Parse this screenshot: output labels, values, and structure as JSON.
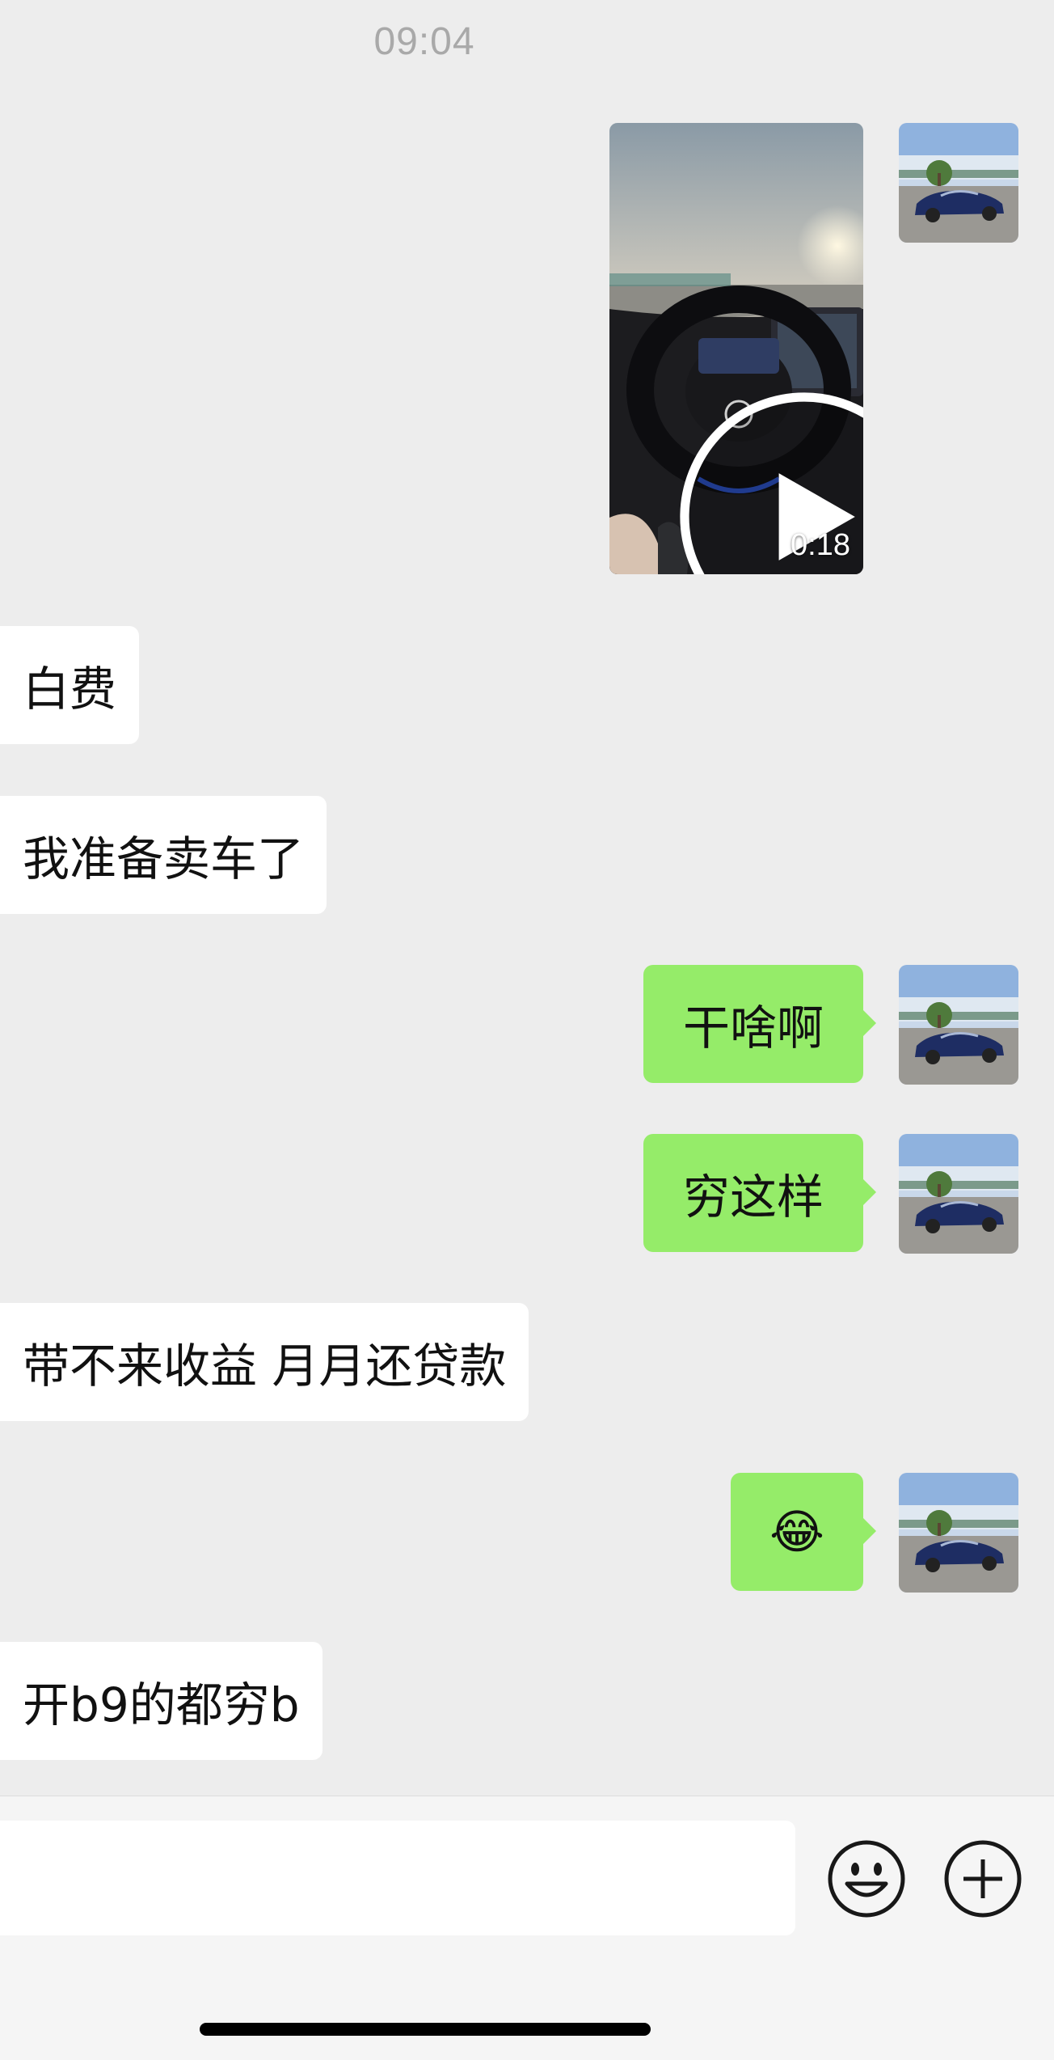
{
  "chat": {
    "timestamp": "09:04",
    "video": {
      "duration": "0:18"
    },
    "messages": [
      {
        "side": "in",
        "text": "白费"
      },
      {
        "side": "in",
        "text": "我准备卖车了"
      },
      {
        "side": "out",
        "text": "干啥啊"
      },
      {
        "side": "out",
        "text": "穷这样"
      },
      {
        "side": "in",
        "text": "带不来收益 月月还贷款"
      },
      {
        "side": "out",
        "text": "😂"
      },
      {
        "side": "in",
        "text": "开b9的都穷b"
      }
    ]
  },
  "input_bar": {
    "placeholder": ""
  },
  "icons": {
    "emoji": "emoji-smile-icon",
    "more": "plus-circle-icon",
    "play": "play-icon",
    "avatar": "car-avatar"
  },
  "colors": {
    "background": "#ededed",
    "incoming_bubble": "#ffffff",
    "outgoing_bubble": "#95ec69",
    "timestamp": "#a9a9a9"
  }
}
